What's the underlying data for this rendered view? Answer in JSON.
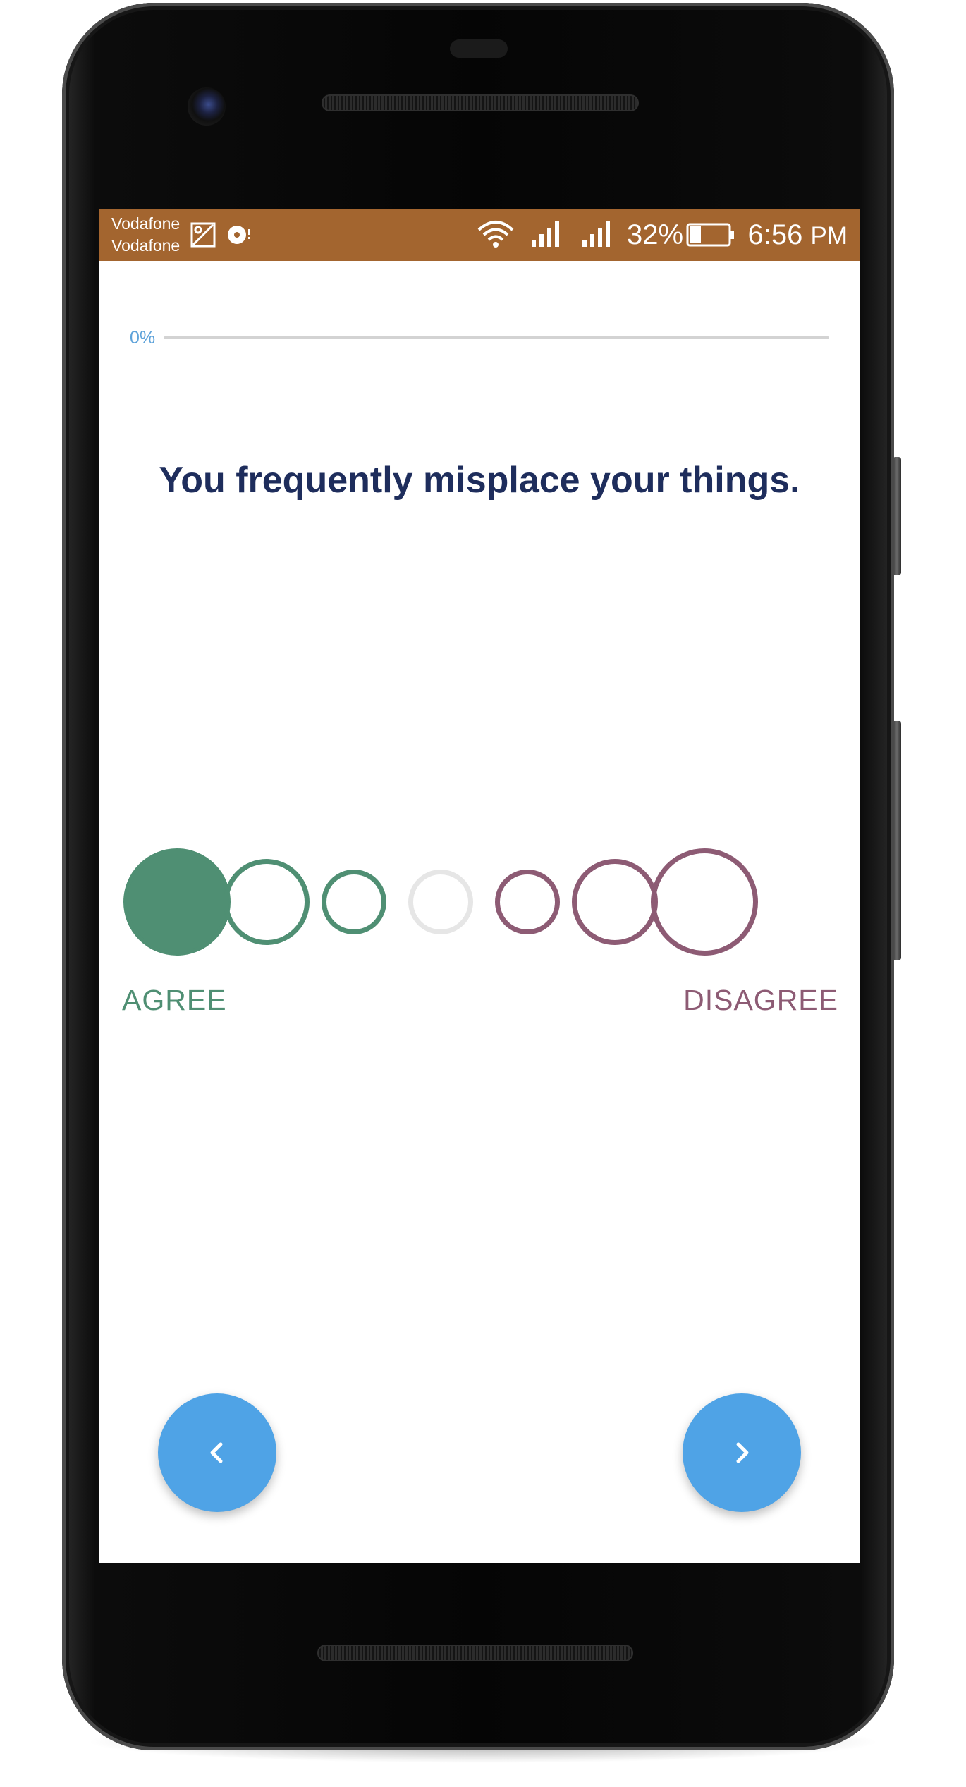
{
  "status_bar": {
    "carrier_line_1": "Vodafone",
    "carrier_line_2": "Vodafone",
    "icons": [
      "image-notification-icon",
      "sync-notification-icon",
      "wifi-icon",
      "signal-icon",
      "signal-icon"
    ],
    "battery_percent": "32%",
    "time": "6:56",
    "time_suffix": "PM",
    "background_color": "#a3652f"
  },
  "progress": {
    "label": "0%",
    "value": 0
  },
  "question": {
    "text": "You frequently misplace your things."
  },
  "scale": {
    "options": [
      {
        "state": "selected",
        "color": "#4f8f73"
      },
      {
        "state": "unselected",
        "color": "#4f8f73"
      },
      {
        "state": "unselected",
        "color": "#4f8f73"
      },
      {
        "state": "unselected",
        "color": "#e6e6e6"
      },
      {
        "state": "unselected",
        "color": "#8d5b74"
      },
      {
        "state": "unselected",
        "color": "#8d5b74"
      },
      {
        "state": "unselected",
        "color": "#8d5b74"
      }
    ],
    "agree_label": "AGREE",
    "disagree_label": "DISAGREE",
    "agree_color": "#4f8f73",
    "disagree_color": "#8d5b74"
  },
  "navigation": {
    "prev_icon": "chevron-left-icon",
    "next_icon": "chevron-right-icon",
    "button_color": "#4fa3e6"
  }
}
